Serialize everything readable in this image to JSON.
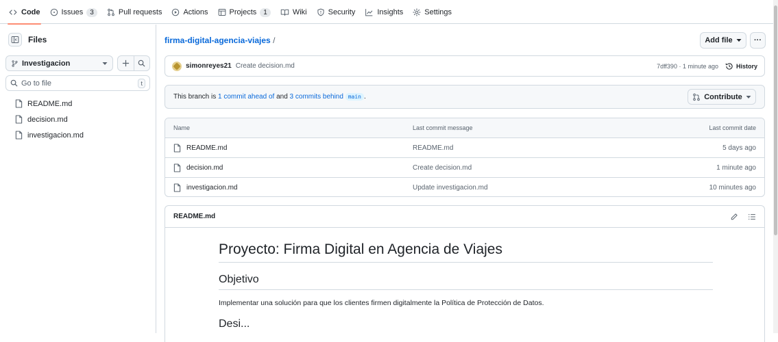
{
  "nav": {
    "tabs": [
      {
        "label": "Code",
        "icon": "code-icon"
      },
      {
        "label": "Issues",
        "icon": "issue-opened-icon",
        "count": "3"
      },
      {
        "label": "Pull requests",
        "icon": "git-pull-request-icon"
      },
      {
        "label": "Actions",
        "icon": "play-icon"
      },
      {
        "label": "Projects",
        "icon": "table-icon",
        "count": "1"
      },
      {
        "label": "Wiki",
        "icon": "book-icon"
      },
      {
        "label": "Security",
        "icon": "shield-icon"
      },
      {
        "label": "Insights",
        "icon": "graph-icon"
      },
      {
        "label": "Settings",
        "icon": "gear-icon"
      }
    ],
    "selected": "Code",
    "accent_color": "#fd8c73"
  },
  "sidebar": {
    "title": "Files",
    "branch": "Investigacion",
    "search_placeholder": "Go to file",
    "search_shortcut": "t",
    "files": [
      "README.md",
      "decision.md",
      "investigacion.md"
    ]
  },
  "repo": {
    "name": "firma-digital-agencia-viajes",
    "separator": "/",
    "add_file_label": "Add file",
    "more_label": "···"
  },
  "latest_commit": {
    "author": "simonreyes21",
    "message": "Create decision.md",
    "meta": "7dff390 · 1 minute ago",
    "history_label": "History"
  },
  "branch_status": {
    "prefix": "This branch is",
    "ahead": "1 commit ahead of",
    "and": "and",
    "behind": "3 commits behind",
    "base": "main",
    "suffix": ".",
    "contribute_label": "Contribute"
  },
  "file_table": {
    "headers": {
      "name": "Name",
      "message": "Last commit message",
      "date": "Last commit date"
    },
    "rows": [
      {
        "name": "README.md",
        "message": "README.md",
        "date": "5 days ago"
      },
      {
        "name": "decision.md",
        "message": "Create decision.md",
        "date": "1 minute ago"
      },
      {
        "name": "investigacion.md",
        "message": "Update investigacion.md",
        "date": "10 minutes ago"
      }
    ]
  },
  "readme": {
    "filename": "README.md",
    "h1": "Proyecto: Firma Digital en Agencia de Viajes",
    "h2": "Objetivo",
    "paragraph": "Implementar una solución para que los clientes firmen digitalmente la Política de Protección de Datos.",
    "next_heading_partial": "Desi..."
  }
}
